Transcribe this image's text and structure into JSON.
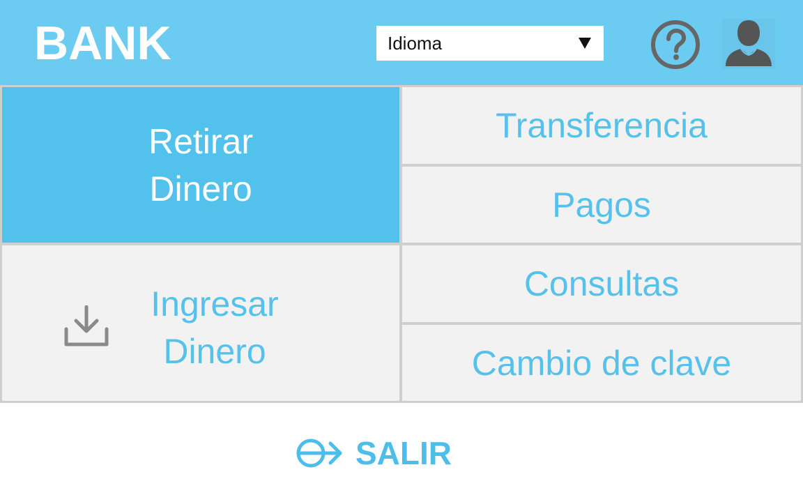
{
  "header": {
    "logo": "BANK",
    "language_select": {
      "selected": "Idioma"
    },
    "help_icon": "question-circle-icon",
    "user_icon": "user-avatar-icon"
  },
  "menu": {
    "retirar": {
      "line1": "Retirar",
      "line2": "Dinero"
    },
    "ingresar": {
      "line1": "Ingresar",
      "line2": "Dinero",
      "icon": "download-icon"
    },
    "transferencia": "Transferencia",
    "pagos": "Pagos",
    "consultas": "Consultas",
    "cambio_clave": "Cambio de clave"
  },
  "footer": {
    "logout_label": "SALIR",
    "logout_icon": "exit-arrow-icon"
  },
  "colors": {
    "header_bg": "#6bcbf0",
    "primary_tile": "#52c1ec",
    "tile_bg": "#f2f2f2",
    "tile_text": "#56c1ea",
    "icon_gray": "#666666"
  }
}
